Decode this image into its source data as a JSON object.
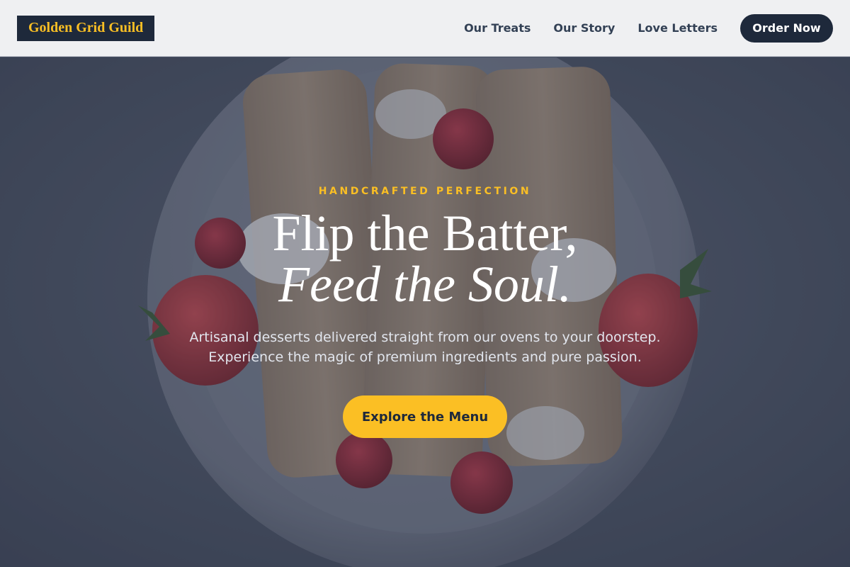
{
  "header": {
    "logo": "Golden Grid Guild",
    "nav": [
      {
        "label": "Our Treats"
      },
      {
        "label": "Our Story"
      },
      {
        "label": "Love Letters"
      }
    ],
    "order_label": "Order Now"
  },
  "hero": {
    "eyebrow": "HANDCRAFTED PERFECTION",
    "headline_line1": "Flip the Batter,",
    "headline_line2": "Feed the Soul.",
    "subtext_line1": "Artisanal desserts delivered straight from our ovens to your doorstep.",
    "subtext_line2": "Experience the magic of premium ingredients and pure passion.",
    "cta_label": "Explore the Menu"
  },
  "colors": {
    "accent": "#fbbf24",
    "dark": "#1e293b",
    "header_bg": "#eff0f2"
  }
}
